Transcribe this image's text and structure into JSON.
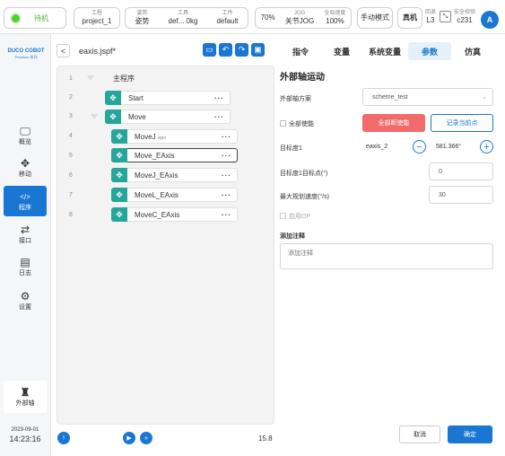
{
  "topbar": {
    "status": "待机",
    "project": {
      "label": "工程",
      "value": "project_1"
    },
    "pose": {
      "label": "姿势",
      "value": "姿势"
    },
    "tool": {
      "label": "工具",
      "value": "def... 0kg"
    },
    "workpiece": {
      "label": "工件",
      "value": "default"
    },
    "speed_pct": "70%",
    "jog": {
      "label": "JOG",
      "value": "关节JOG"
    },
    "global_speed": {
      "label": "全局速度",
      "value": "100%"
    },
    "mode": "手动模式",
    "real": "真机",
    "safety_level": {
      "label": "回退",
      "value": "L3"
    },
    "safety_check": {
      "label": "安全校验",
      "value": "c231"
    },
    "avatar": "A"
  },
  "sidebar": {
    "brand": "DUCO COBOT",
    "brand_sub": "Premium 系列",
    "items": [
      {
        "icon": "monitor-icon",
        "label": "概览"
      },
      {
        "icon": "move-icon",
        "label": "移动"
      },
      {
        "icon": "code-icon",
        "label": "程序"
      },
      {
        "icon": "interface-icon",
        "label": "接口"
      },
      {
        "icon": "calendar-icon",
        "label": "日志"
      },
      {
        "icon": "gear-icon",
        "label": "设置"
      }
    ],
    "external_axis": "外部轴",
    "date": "2023-09-01",
    "time": "14:23:16"
  },
  "program": {
    "filename": "eaxis.jspf*",
    "lines": [
      {
        "num": "1",
        "label": "主程序"
      },
      {
        "num": "2",
        "label": "Start"
      },
      {
        "num": "3",
        "label": "Move"
      },
      {
        "num": "4",
        "label": "MoveJ",
        "sub": "wpo"
      },
      {
        "num": "5",
        "label": "Move_EAxis"
      },
      {
        "num": "6",
        "label": "MoveJ_EAxis"
      },
      {
        "num": "7",
        "label": "MoveL_EAxis"
      },
      {
        "num": "8",
        "label": "MoveC_EAxis"
      }
    ],
    "progress": "15.8"
  },
  "tabs": [
    "指令",
    "变量",
    "系统变量",
    "参数",
    "仿真"
  ],
  "panel": {
    "title": "外部轴运动",
    "scheme_label": "外部轴方案",
    "scheme_value": "scheme_test",
    "all_enable_label": "全部使能",
    "all_enable_btn": "全部断使能",
    "record_btn": "记录当前点",
    "target1_label": "目标度1",
    "target1_axis": "eaxis_2",
    "target1_value": "581.366°",
    "target1_mark_label": "目标度1目标点(°)",
    "target1_mark_value": "0",
    "max_speed_label": "最大规划速度(°/s)",
    "max_speed_value": "30",
    "enable_op_label": "启用OP",
    "comment_label": "添加注释",
    "comment_placeholder": "添加注释",
    "cancel": "取消",
    "confirm": "确定"
  },
  "colors": {
    "accent": "#1976d2",
    "teal": "#26a69a",
    "red": "#f26b6b",
    "status_green": "#4cd137"
  }
}
